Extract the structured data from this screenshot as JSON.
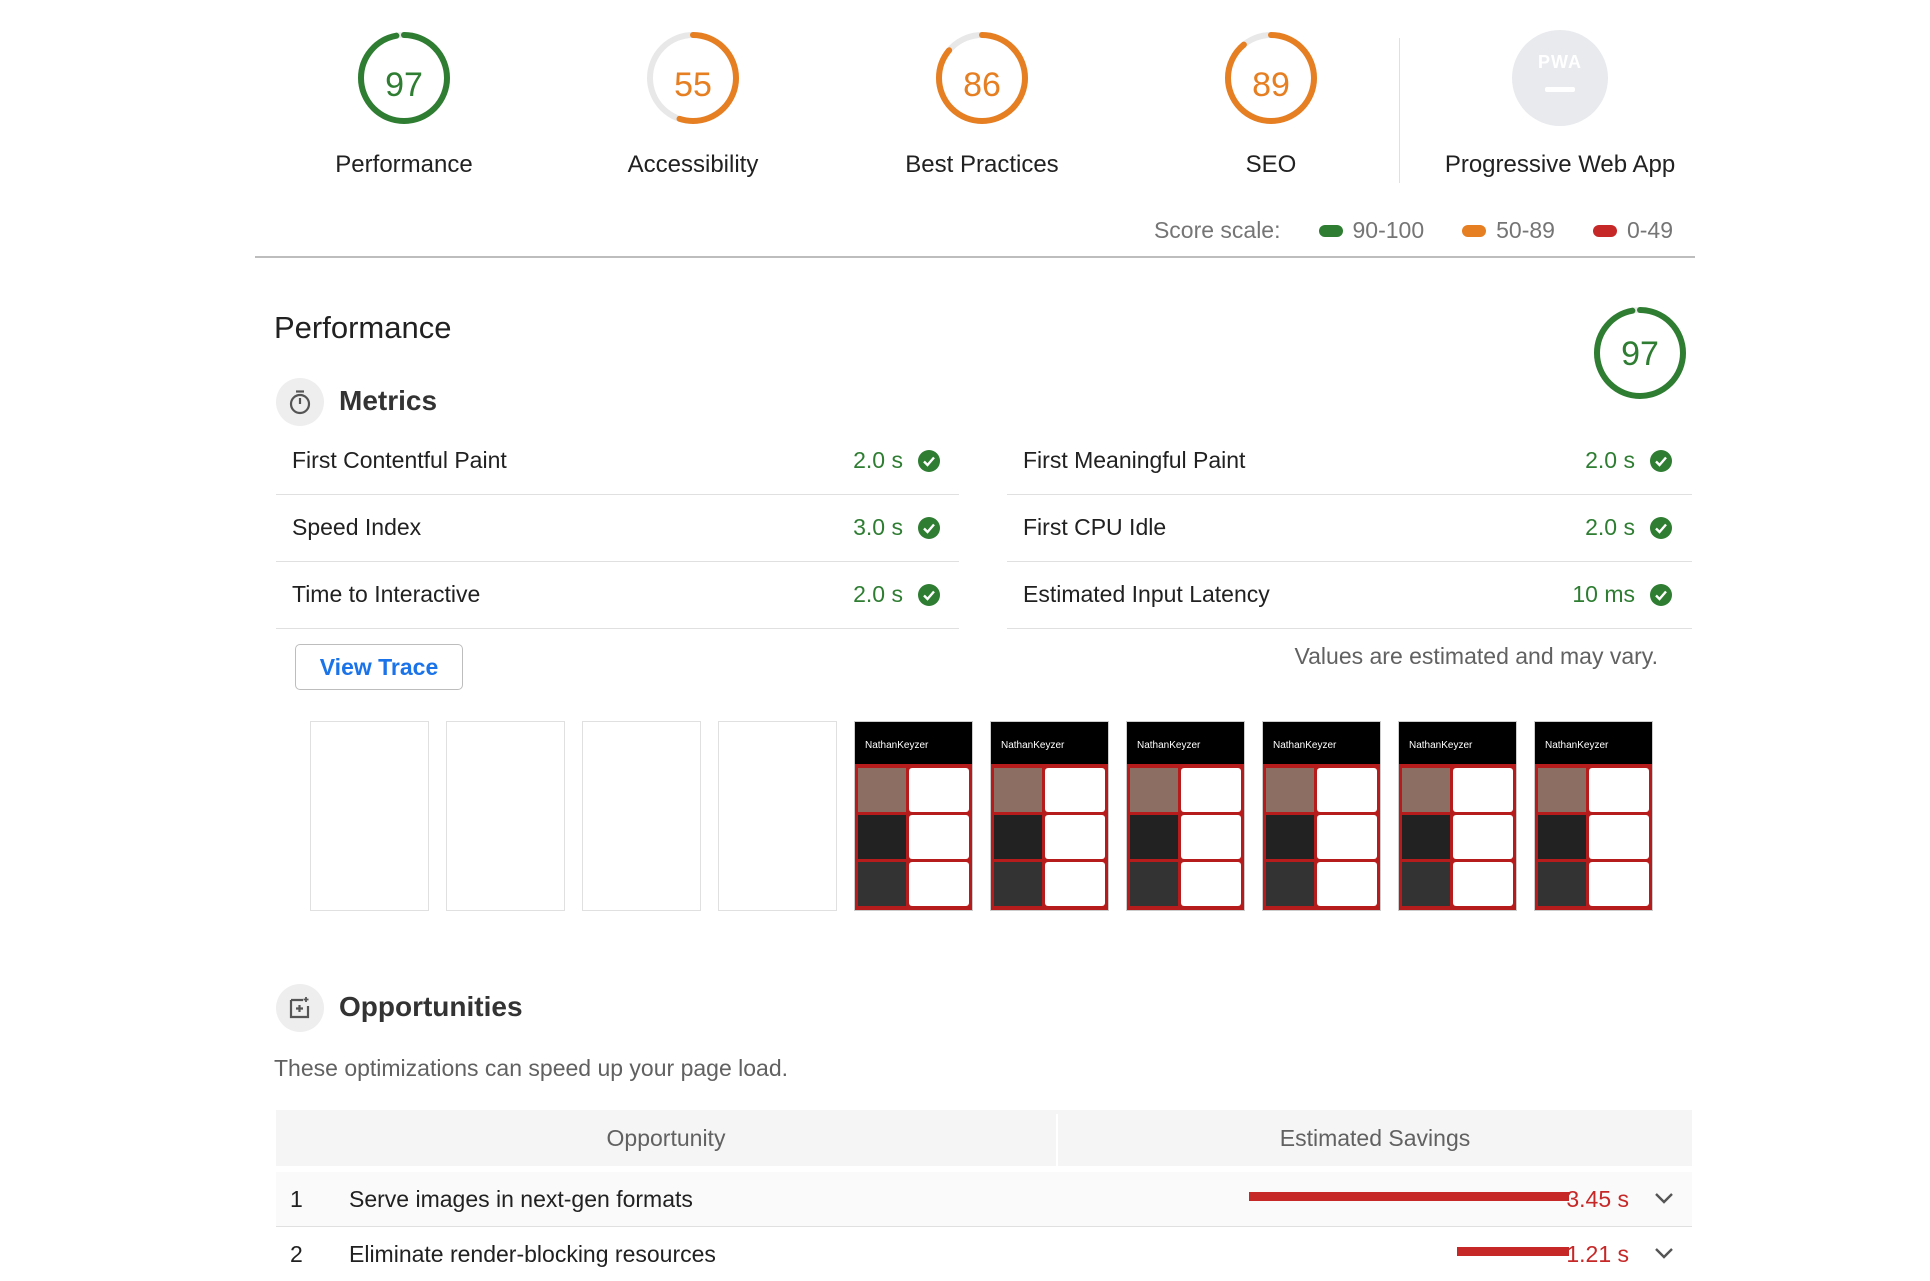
{
  "gauges": [
    {
      "score": "97",
      "label": "Performance",
      "color": "#2e7d32",
      "fraction": 0.97
    },
    {
      "score": "55",
      "label": "Accessibility",
      "color": "#e67e22",
      "fraction": 0.55
    },
    {
      "score": "86",
      "label": "Best Practices",
      "color": "#e67e22",
      "fraction": 0.86
    },
    {
      "score": "89",
      "label": "SEO",
      "color": "#e67e22",
      "fraction": 0.89
    }
  ],
  "pwa": {
    "badge": "PWA",
    "label": "Progressive Web App"
  },
  "score_scale": {
    "label": "Score scale:",
    "ranges": [
      {
        "text": "90-100",
        "color": "#2e7d32"
      },
      {
        "text": "50-89",
        "color": "#e67e22"
      },
      {
        "text": "0-49",
        "color": "#c62828"
      }
    ]
  },
  "performance": {
    "title": "Performance",
    "score": "97",
    "fraction": 0.97,
    "metrics_title": "Metrics",
    "metrics": [
      {
        "name": "First Contentful Paint",
        "value": "2.0 s"
      },
      {
        "name": "First Meaningful Paint",
        "value": "2.0 s"
      },
      {
        "name": "Speed Index",
        "value": "3.0 s"
      },
      {
        "name": "First CPU Idle",
        "value": "2.0 s"
      },
      {
        "name": "Time to Interactive",
        "value": "2.0 s"
      },
      {
        "name": "Estimated Input Latency",
        "value": "10 ms"
      }
    ],
    "view_trace": "View Trace",
    "estimate_note": "Values are estimated and may vary.",
    "filmstrip_site_name": "NathanKeyzer"
  },
  "opportunities": {
    "title": "Opportunities",
    "description": "These optimizations can speed up your page load.",
    "col_opportunity": "Opportunity",
    "col_savings": "Estimated Savings",
    "rows": [
      {
        "index": "1",
        "title": "Serve images in next-gen formats",
        "savings": "3.45 s",
        "seconds": 3.45
      },
      {
        "index": "2",
        "title": "Eliminate render-blocking resources",
        "savings": "1.21 s",
        "seconds": 1.21
      }
    ]
  }
}
